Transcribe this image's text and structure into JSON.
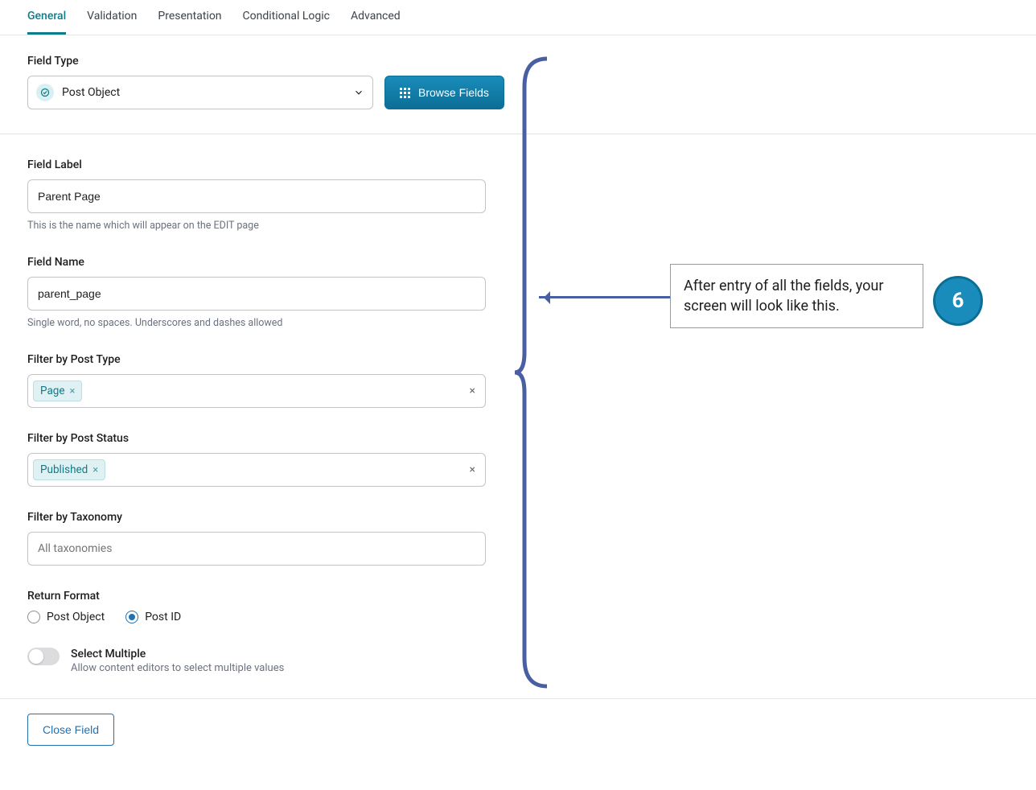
{
  "tabs": [
    "General",
    "Validation",
    "Presentation",
    "Conditional Logic",
    "Advanced"
  ],
  "active_tab": 0,
  "field_type": {
    "label": "Field Type",
    "value": "Post Object",
    "browse_label": "Browse Fields"
  },
  "field_label": {
    "label": "Field Label",
    "value": "Parent Page",
    "help": "This is the name which will appear on the EDIT page"
  },
  "field_name": {
    "label": "Field Name",
    "value": "parent_page",
    "help": "Single word, no spaces. Underscores and dashes allowed"
  },
  "filter_post_type": {
    "label": "Filter by Post Type",
    "tags": [
      "Page"
    ]
  },
  "filter_post_status": {
    "label": "Filter by Post Status",
    "tags": [
      "Published"
    ]
  },
  "filter_taxonomy": {
    "label": "Filter by Taxonomy",
    "placeholder": "All taxonomies"
  },
  "return_format": {
    "label": "Return Format",
    "options": [
      "Post Object",
      "Post ID"
    ],
    "selected": 1
  },
  "select_multiple": {
    "label": "Select Multiple",
    "desc": "Allow content editors to select multiple values",
    "value": false
  },
  "close_label": "Close Field",
  "annotation": {
    "text": "After entry of all the fields, your screen will look like this.",
    "step": "6"
  }
}
